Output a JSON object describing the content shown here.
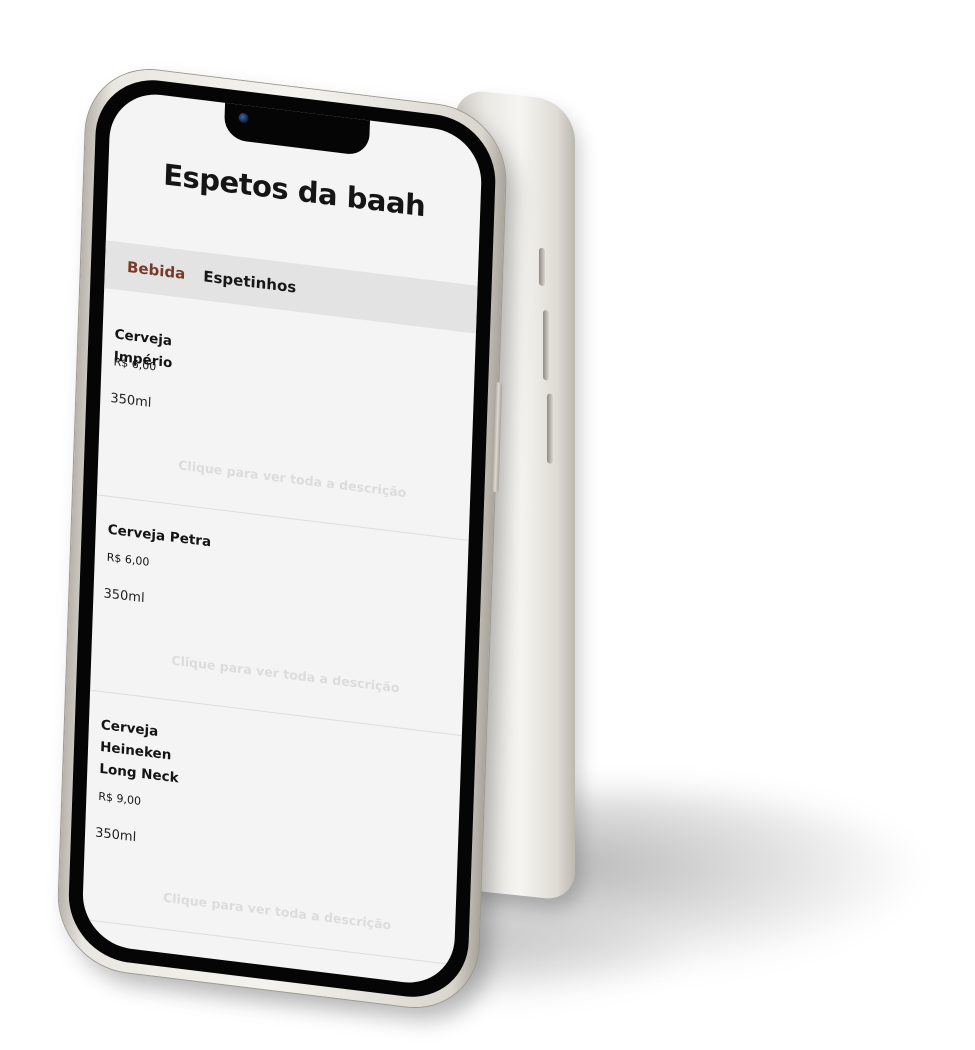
{
  "header": {
    "title": "Espetos da baah"
  },
  "tabs": [
    {
      "label": "Bebida",
      "active": true
    },
    {
      "label": "Espetinhos",
      "active": false
    }
  ],
  "colors": {
    "active_tab": "#7a3a2a",
    "tab_bar_bg": "#e3e3e3",
    "screen_bg": "#f4f4f4"
  },
  "items": [
    {
      "name": "Cerveja Império",
      "price": "R$ 6,00",
      "description": "350ml",
      "hint": "Clique para ver toda a descrição"
    },
    {
      "name": "Cerveja Petra",
      "price": "R$ 6,00",
      "description": "350ml",
      "hint": "Clique para ver toda a descrição"
    },
    {
      "name": "Cerveja Heineken Long Neck",
      "price": "R$ 9,00",
      "description": "350ml",
      "hint": "Clique para ver toda a descrição"
    }
  ]
}
